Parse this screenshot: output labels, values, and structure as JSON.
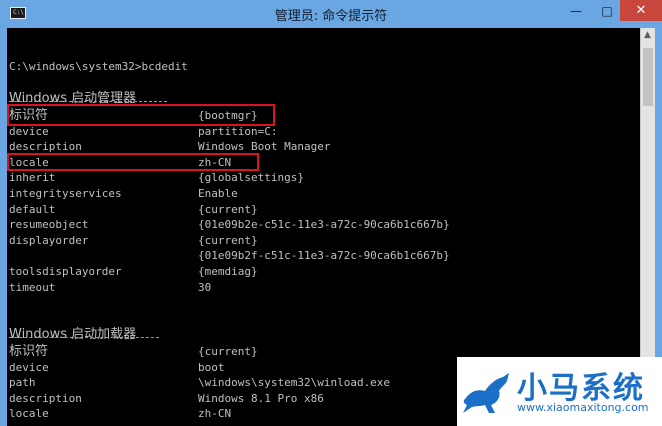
{
  "titlebar": {
    "icon_text": "C:\\",
    "title": "管理员: 命令提示符",
    "minimize": "—",
    "maximize": "□",
    "close": "✕"
  },
  "console": {
    "prompt_line": "C:\\windows\\system32>bcdedit",
    "section1_title": "Windows 启动管理器",
    "section1_rows": [
      {
        "key": "标识符",
        "value": "{bootmgr}"
      },
      {
        "key": "device",
        "value": "partition=C:"
      },
      {
        "key": "description",
        "value": "Windows Boot Manager"
      },
      {
        "key": "locale",
        "value": "zh-CN"
      },
      {
        "key": "inherit",
        "value": "{globalsettings}"
      },
      {
        "key": "integrityservices",
        "value": "Enable"
      },
      {
        "key": "default",
        "value": "{current}"
      },
      {
        "key": "resumeobject",
        "value": "{01e09b2e-c51c-11e3-a72c-90ca6b1c667b}"
      },
      {
        "key": "displayorder",
        "value": "{current}"
      },
      {
        "key": "",
        "value": "{01e09b2f-c51c-11e3-a72c-90ca6b1c667b}"
      },
      {
        "key": "toolsdisplayorder",
        "value": "{memdiag}"
      },
      {
        "key": "timeout",
        "value": "30"
      }
    ],
    "section2_title": "Windows 启动加载器",
    "section2_rows": [
      {
        "key": "标识符",
        "value": "{current}"
      },
      {
        "key": "device",
        "value": "boot"
      },
      {
        "key": "path",
        "value": "\\windows\\system32\\winload.exe"
      },
      {
        "key": "description",
        "value": "Windows 8.1 Pro x86"
      },
      {
        "key": "locale",
        "value": "zh-CN"
      }
    ]
  },
  "watermark": {
    "brand": "小马系统",
    "url": "www.xiaomaxitong.com"
  },
  "colors": {
    "titlebar": "#6aa7e2",
    "console_bg": "#000000",
    "console_text": "#c0c0c0",
    "highlight_box": "#d8141e",
    "close_button": "#c9463d",
    "brand": "#1b6fc6"
  },
  "icons": {
    "app": "cmd-icon",
    "logo": "horse-logo-icon"
  }
}
